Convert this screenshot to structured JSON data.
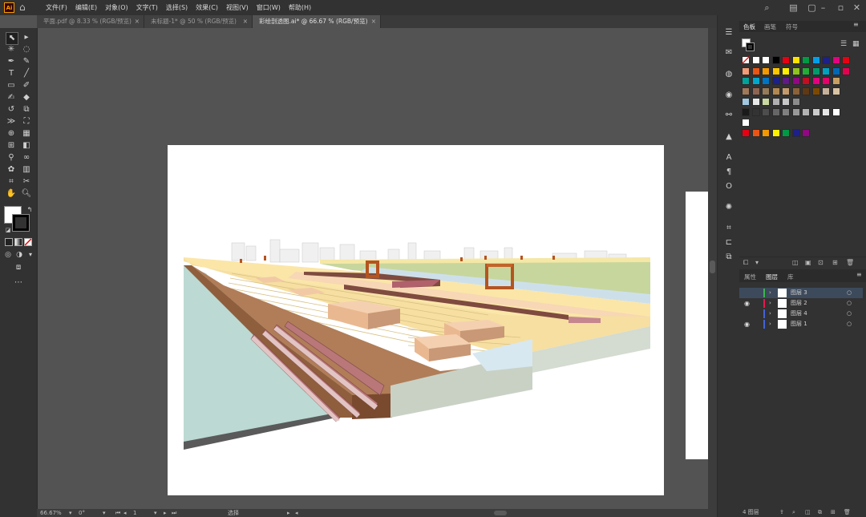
{
  "app": {
    "logo": "Ai"
  },
  "menu": [
    "文件(F)",
    "编辑(E)",
    "对象(O)",
    "文字(T)",
    "选择(S)",
    "效果(C)",
    "视图(V)",
    "窗口(W)",
    "帮助(H)"
  ],
  "tabs": [
    {
      "label": "平面.pdf @ 8.33 % (RGB/预览)"
    },
    {
      "label": "未标题-1* @ 50 % (RGB/预览)"
    },
    {
      "label": "彩绘剖透图.ai* @ 66.67 % (RGB/预览)"
    }
  ],
  "status": {
    "zoom": "66.67%",
    "rotation": "0°",
    "page": "1",
    "tool": "选择"
  },
  "swatches_panel": {
    "tabs": [
      "色板",
      "画笔",
      "符号"
    ],
    "rows": [
      [
        "#ffffff",
        "#ffffff",
        "#ffffff",
        "#000000",
        "#e60012",
        "#ffe100",
        "#009944",
        "#00a0e9",
        "#1d2088",
        "#e4007f",
        "#e60012"
      ],
      [
        "#f29b76",
        "#ea5514",
        "#f39800",
        "#fcc800",
        "#fff100",
        "#8fc31f",
        "#22ac38",
        "#009b6b",
        "#00a0c1",
        "#0068b7",
        "#e5004f"
      ],
      [
        "#00a29a",
        "#00a7ca",
        "#0075c2",
        "#1d2088",
        "#601986",
        "#920783",
        "#c30d23",
        "#e4007f",
        "#e5006a",
        "#c8a063"
      ],
      [
        "#a0785a",
        "#8f6552",
        "#957b59",
        "#b28850",
        "#c49a6c",
        "#8c6239",
        "#603813",
        "#7d4900",
        "#c7b299",
        "#d9c3a2"
      ],
      [
        "#a0c8e0",
        "#e8e8e8",
        "#c8d8a0",
        "#b0b0b0",
        "#c8c8c8",
        "#8c8c8c"
      ],
      [
        "#1a1a1a",
        "#333333",
        "#4d4d4d",
        "#666666",
        "#808080",
        "#999999",
        "#b3b3b3",
        "#cccccc",
        "#e6e6e6",
        "#ffffff"
      ],
      [
        "#ffffff"
      ],
      [
        "#e60012",
        "#ea5514",
        "#f39800",
        "#fff100",
        "#009944",
        "#1d2088",
        "#920783"
      ]
    ]
  },
  "layers_panel": {
    "tabs": [
      "属性",
      "图层",
      "库"
    ],
    "layers": [
      {
        "name": "图层 3",
        "color": "#3cb44b",
        "visible": false
      },
      {
        "name": "图层 2",
        "color": "#e6194b",
        "visible": true
      },
      {
        "name": "图层 4",
        "color": "#4363d8",
        "visible": false
      },
      {
        "name": "图层 1",
        "color": "#4363d8",
        "visible": true
      }
    ],
    "footer": "4 图层"
  }
}
